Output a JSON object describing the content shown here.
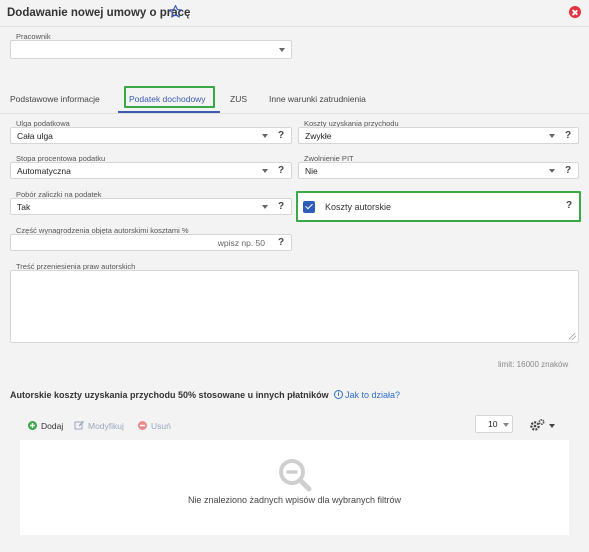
{
  "header": {
    "title": "Dodawanie nowej umowy o pracę"
  },
  "pracownik": {
    "label": "Pracownik",
    "value": ""
  },
  "tabs": [
    {
      "label": "Podstawowe informacje"
    },
    {
      "label": "Podatek dochodowy"
    },
    {
      "label": "ZUS"
    },
    {
      "label": "Inne warunki zatrudnienia"
    }
  ],
  "fields": {
    "ulga": {
      "label": "Ulga podatkowa",
      "value": "Cała ulga"
    },
    "koszty_uzyskania": {
      "label": "Koszty uzyskania przychodu",
      "value": "Zwykłe"
    },
    "stopa": {
      "label": "Stopa procentowa podatku",
      "value": "Automatyczna"
    },
    "zwolnienie": {
      "label": "Zwolnienie PIT",
      "value": "Nie"
    },
    "pobor": {
      "label": "Pobór zaliczki na podatek",
      "value": "Tak"
    },
    "koszty_autorskie": {
      "label": "Koszty autorskie",
      "checked": true
    },
    "czesc": {
      "label": "Część wynagrodzenia objęta autorskimi kosztami %",
      "placeholder": "wpisz np. 50"
    },
    "tresc": {
      "label": "Treść przeniesienia praw autorskich",
      "limit": "limit: 16000 znaków"
    }
  },
  "help_mark": "?",
  "section": {
    "title": "Autorskie koszty uzyskania przychodu 50% stosowane u innych płatników",
    "info_icon": "i",
    "link": "Jak to działa?"
  },
  "toolbar": {
    "add": "Dodaj",
    "modify": "Modyfikuj",
    "delete": "Usuń",
    "page_size": "10"
  },
  "empty_state": {
    "text": "Nie znaleziono żadnych wpisów dla wybranych filtrów"
  },
  "colors": {
    "accent": "#3c5bb1",
    "highlight": "#3aa847",
    "close": "#e2343f",
    "link": "#2f6fcb",
    "add_icon": "#3aa847",
    "delete_icon": "#e88a8f",
    "disabled_text": "#9aa7bd"
  },
  "icons": [
    "star-icon",
    "close-icon",
    "chevron-down-icon",
    "help-icon",
    "checkbox-checked-icon",
    "info-icon",
    "plus-icon",
    "edit-icon",
    "minus-icon",
    "gear-icon",
    "search-empty-icon",
    "resize-grip-icon"
  ]
}
